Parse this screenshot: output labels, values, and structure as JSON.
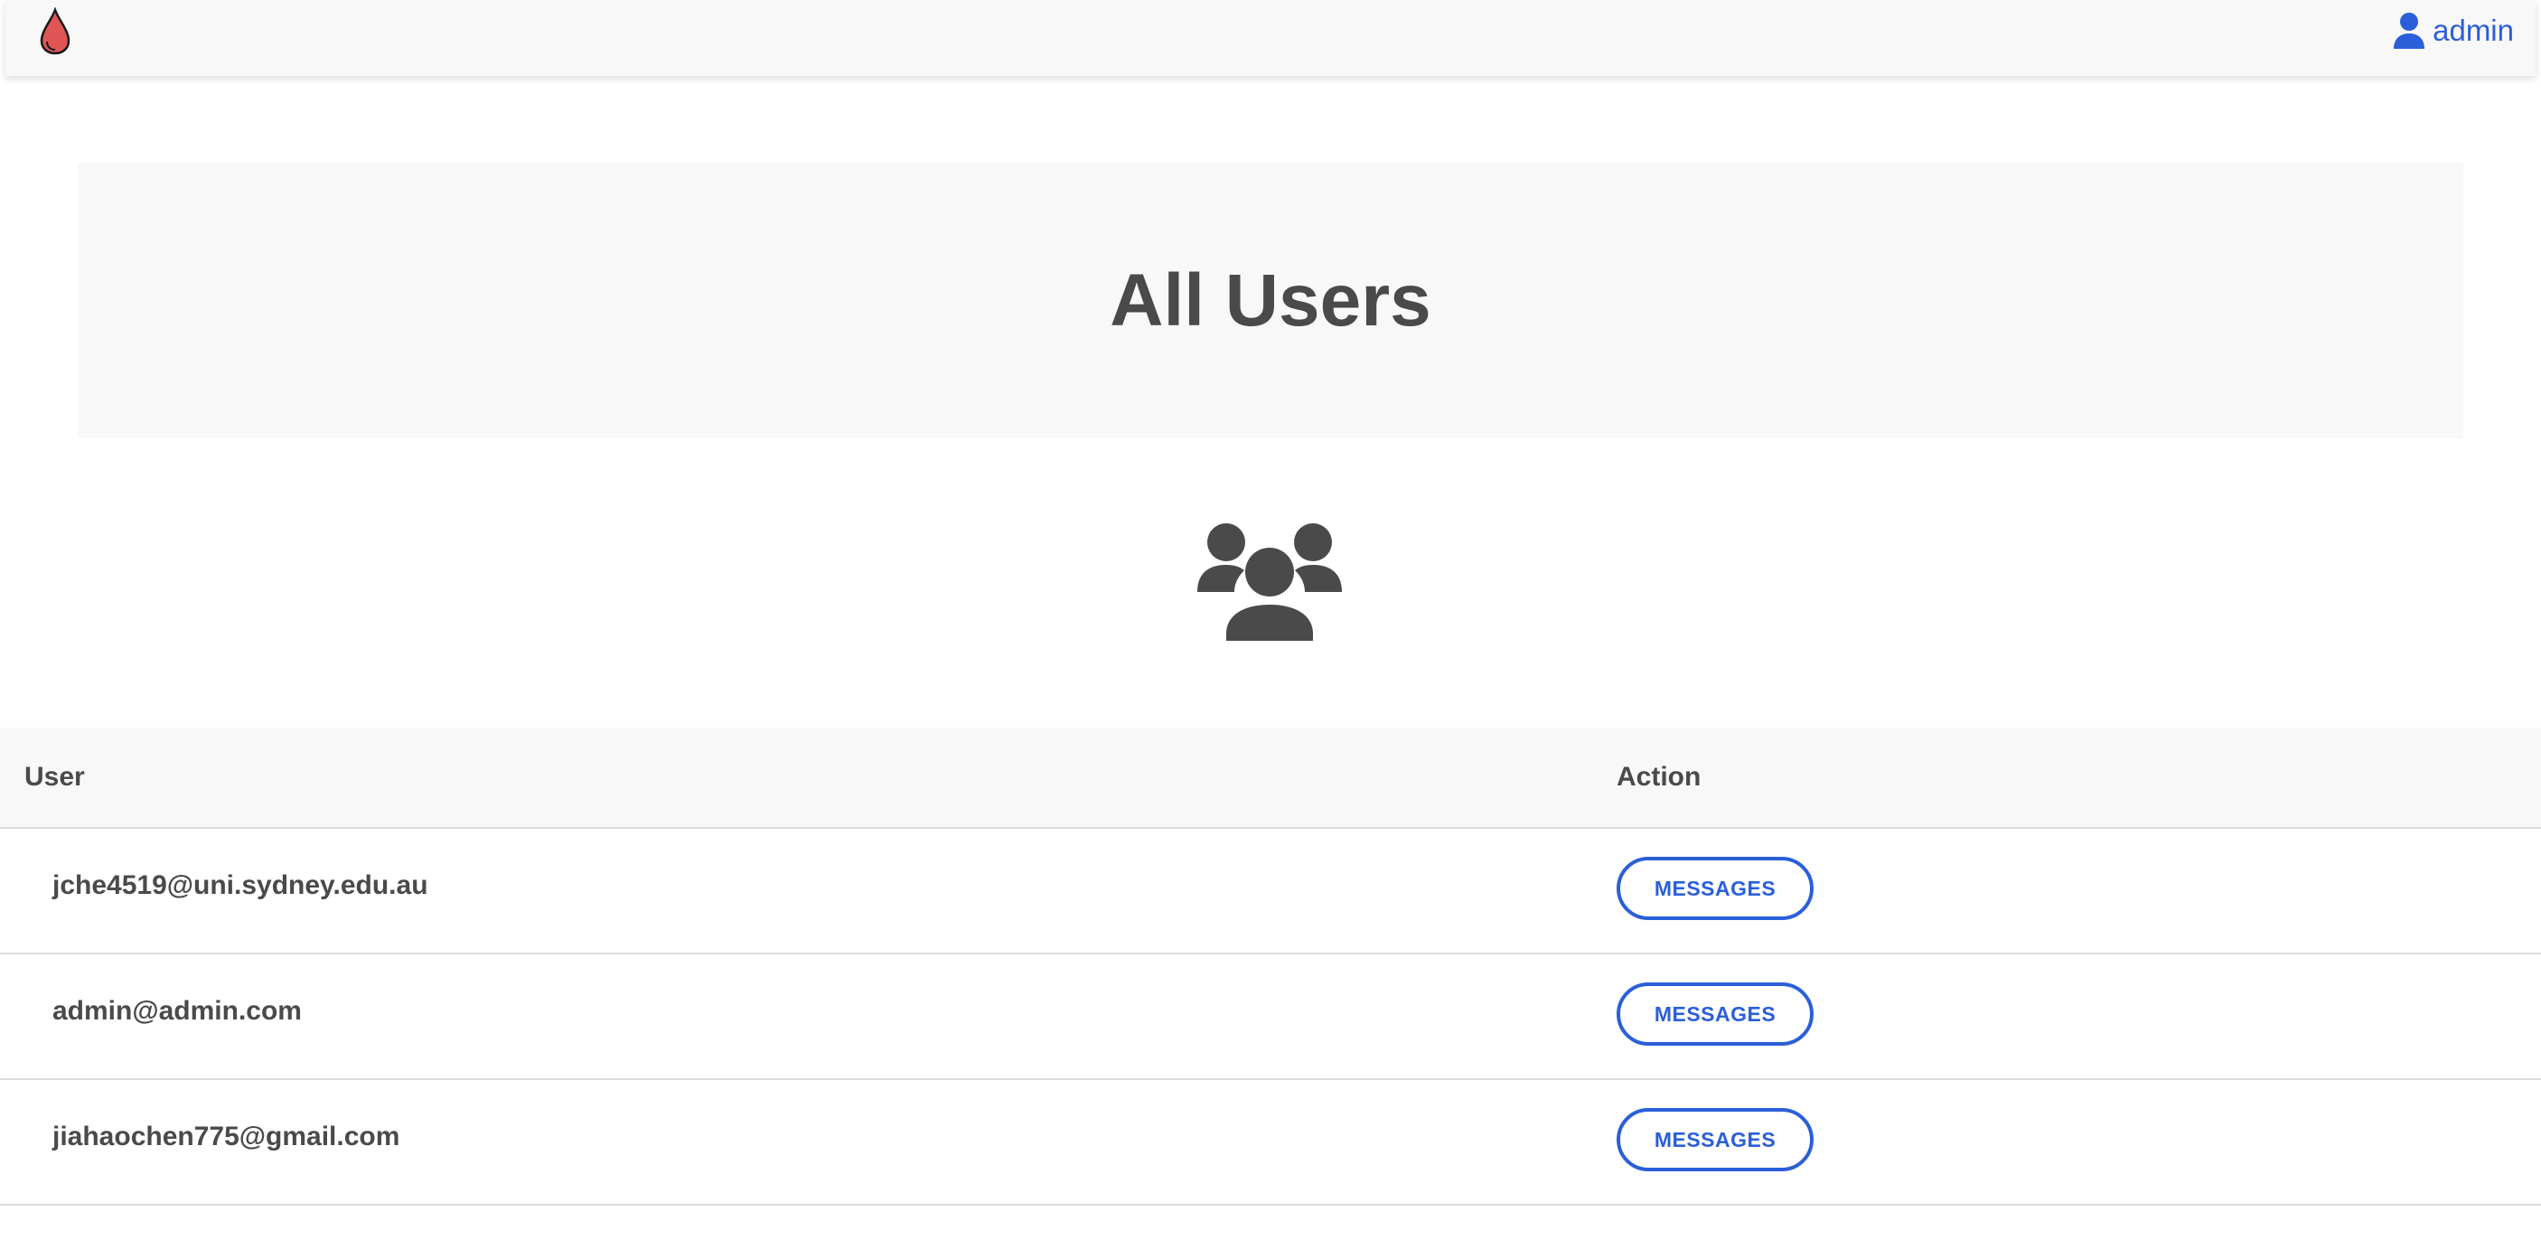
{
  "navbar": {
    "logo_icon": "blood-drop-icon",
    "user_icon": "user-icon",
    "user_label": "admin",
    "accent_color": "#2b5fd9",
    "logo_color": "#e05555"
  },
  "hero": {
    "title": "All Users",
    "icon": "users-group-icon"
  },
  "table": {
    "headers": {
      "user": "User",
      "action": "Action"
    },
    "rows": [
      {
        "email": "jche4519@uni.sydney.edu.au",
        "action_label": "MESSAGES"
      },
      {
        "email": "admin@admin.com",
        "action_label": "MESSAGES"
      },
      {
        "email": "jiahaochen775@gmail.com",
        "action_label": "MESSAGES"
      }
    ]
  }
}
